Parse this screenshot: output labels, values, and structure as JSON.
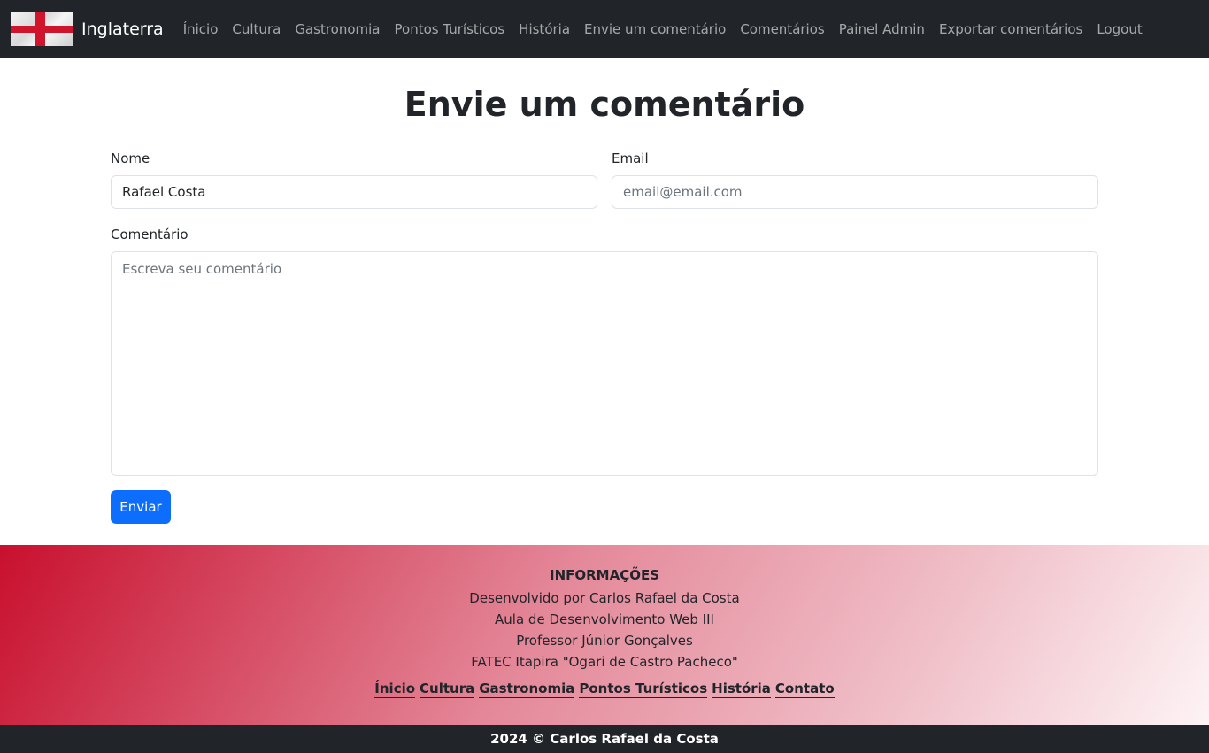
{
  "navbar": {
    "brand": "Inglaterra",
    "links": [
      "Ínicio",
      "Cultura",
      "Gastronomia",
      "Pontos Turísticos",
      "História",
      "Envie um comentário",
      "Comentários",
      "Painel Admin",
      "Exportar comentários",
      "Logout"
    ]
  },
  "main": {
    "title": "Envie um comentário",
    "form": {
      "name_label": "Nome",
      "name_value": "Rafael Costa",
      "email_label": "Email",
      "email_placeholder": "email@email.com",
      "comment_label": "Comentário",
      "comment_placeholder": "Escreva seu comentário",
      "submit_label": "Enviar"
    }
  },
  "footer": {
    "info_title": "INFORMAÇÕES",
    "info_lines": [
      "Desenvolvido por Carlos Rafael da Costa",
      "Aula de Desenvolvimento Web III",
      "Professor Júnior Gonçalves",
      "FATEC Itapira \"Ogari de Castro Pacheco\""
    ],
    "links": [
      "Ínicio",
      "Cultura",
      "Gastronomia",
      "Pontos Turísticos",
      "História",
      "Contato"
    ],
    "copyright": "2024 © Carlos Rafael da Costa"
  },
  "colors": {
    "navbar_bg": "#212529",
    "primary": "#0d6efd",
    "flag_red": "#d0142c"
  },
  "icons": {
    "brand_flag": "england-flag-icon"
  }
}
